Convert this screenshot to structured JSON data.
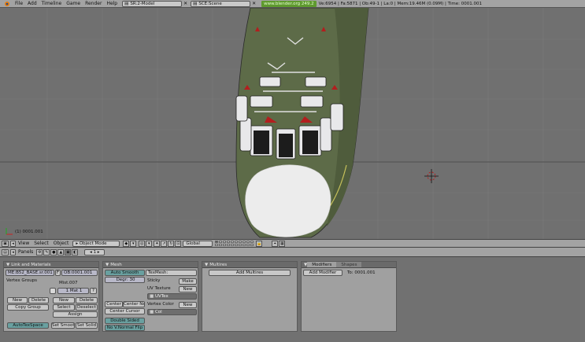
{
  "info_header": {
    "menus": [
      "File",
      "Add",
      "Timeline",
      "Game",
      "Render",
      "Help"
    ],
    "screen_name": "SR:2-Model",
    "scene_name": "SCE:Scene",
    "url": "www.blender.org 249.2",
    "stats": "Ve:6954 | Fa:5871 | Ob:49-1 | La:0 | Mem:19.46M (0.09M) | Time: 0001.001"
  },
  "viewport": {
    "frame_label": "(1) 0001.001"
  },
  "view_header": {
    "menus": [
      "View",
      "Select",
      "Object"
    ],
    "mode": "Object Mode",
    "pivot": "Global"
  },
  "buttons_header": {
    "panels_label": "Panels",
    "page": "1"
  },
  "panel_link": {
    "title": "Link and Materials",
    "me_name": "ME:B52_BASE.sr.001",
    "f_label": "F",
    "ob_name": "OB:0001.001",
    "vertex_groups": "Vertex Groups",
    "mat_name": "Mist.007",
    "mat_index": "1 Mat 1",
    "question": "?",
    "new": "New",
    "delete": "Delete",
    "copy_group": "Copy Group",
    "new2": "New",
    "delete2": "Delete",
    "select": "Select",
    "deselect": "Deselect",
    "assign": "Assign",
    "autotexspace": "AutoTexSpace",
    "set_smooth": "Set Smooth",
    "set_solid": "Set Solid"
  },
  "panel_mesh": {
    "title": "Mesh",
    "auto_smooth": "Auto Smooth",
    "degr": "Degr: 30",
    "texmesh": "TexMesh:",
    "sticky": "Sticky",
    "make": "Make",
    "uv_texture": "UV Texture",
    "new_uv": "New",
    "uv_name": "UVTex",
    "center": "Center",
    "center_new": "Center New",
    "center_cursor": "Center Cursor",
    "vertex_color": "Vertex Color",
    "new_vc": "New",
    "vc_name": "Col",
    "double_sided": "Double Sided",
    "no_v_normal_flip": "No V.Normal Flip"
  },
  "panel_multires": {
    "title": "Multires",
    "add_multires": "Add Multires"
  },
  "panel_modifiers": {
    "tab_modifiers": "Modifiers",
    "tab_shapes": "Shapes",
    "add_modifier": "Add Modifier",
    "to_label": "To: 0001.001"
  },
  "colors": {
    "header": "#a3a3a3",
    "viewport": "#707070",
    "model_green": "#5d6b48",
    "model_white": "#ececec",
    "url_green": "#5f9a2f"
  }
}
